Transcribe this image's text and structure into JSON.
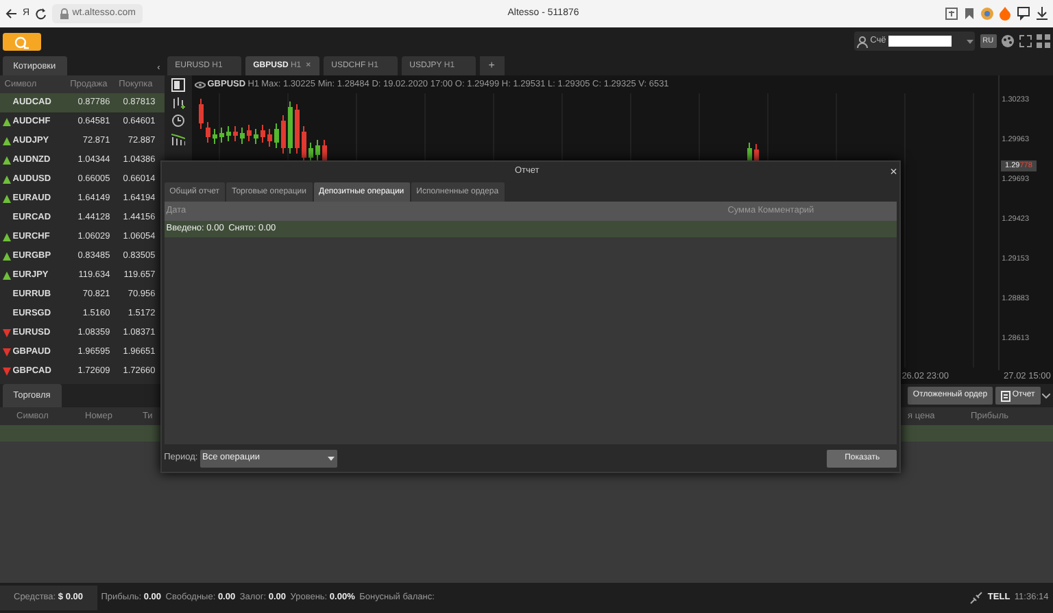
{
  "browser": {
    "logo_letter": "Я",
    "url": "wt.altesso.com",
    "title": "Altesso - 511876"
  },
  "header": {
    "account_prefix": "Счё",
    "language": "RU"
  },
  "quotes_panel": {
    "tab": "Котировки",
    "collapse": "‹",
    "columns": [
      "Символ",
      "Продажа",
      "Покупка"
    ],
    "rows": [
      {
        "symbol": "AUDCAD",
        "sell": "0.87786",
        "buy": "0.87813",
        "rising": false,
        "falling": false,
        "selected": true
      },
      {
        "symbol": "AUDCHF",
        "sell": "0.64581",
        "buy": "0.64601",
        "rising": true,
        "falling": false,
        "selected": false
      },
      {
        "symbol": "AUDJPY",
        "sell": "72.871",
        "buy": "72.887",
        "rising": true,
        "falling": false,
        "selected": false
      },
      {
        "symbol": "AUDNZD",
        "sell": "1.04344",
        "buy": "1.04386",
        "rising": true,
        "falling": false,
        "selected": false
      },
      {
        "symbol": "AUDUSD",
        "sell": "0.66005",
        "buy": "0.66014",
        "rising": true,
        "falling": false,
        "selected": false
      },
      {
        "symbol": "EURAUD",
        "sell": "1.64149",
        "buy": "1.64194",
        "rising": true,
        "falling": false,
        "selected": false
      },
      {
        "symbol": "EURCAD",
        "sell": "1.44128",
        "buy": "1.44156",
        "rising": false,
        "falling": false,
        "selected": false
      },
      {
        "symbol": "EURCHF",
        "sell": "1.06029",
        "buy": "1.06054",
        "rising": true,
        "falling": false,
        "selected": false
      },
      {
        "symbol": "EURGBP",
        "sell": "0.83485",
        "buy": "0.83505",
        "rising": true,
        "falling": false,
        "selected": false
      },
      {
        "symbol": "EURJPY",
        "sell": "119.634",
        "buy": "119.657",
        "rising": true,
        "falling": false,
        "selected": false
      },
      {
        "symbol": "EURRUB",
        "sell": "70.821",
        "buy": "70.956",
        "rising": false,
        "falling": false,
        "selected": false
      },
      {
        "symbol": "EURSGD",
        "sell": "1.5160",
        "buy": "1.5172",
        "rising": false,
        "falling": false,
        "selected": false
      },
      {
        "symbol": "EURUSD",
        "sell": "1.08359",
        "buy": "1.08371",
        "rising": false,
        "falling": true,
        "selected": false
      },
      {
        "symbol": "GBPAUD",
        "sell": "1.96595",
        "buy": "1.96651",
        "rising": false,
        "falling": true,
        "selected": false
      },
      {
        "symbol": "GBPCAD",
        "sell": "1.72609",
        "buy": "1.72660",
        "rising": false,
        "falling": true,
        "selected": false
      }
    ]
  },
  "chart_tabs": [
    {
      "label": "EURUSD",
      "timeframe": "H1",
      "selected": false
    },
    {
      "label": "GBPUSD",
      "timeframe": "H1",
      "selected": true,
      "close_mark": "×"
    },
    {
      "label": "USDCHF",
      "timeframe": "H1",
      "selected": false
    },
    {
      "label": "USDJPY",
      "timeframe": "H1",
      "selected": false
    }
  ],
  "add_tab": "+",
  "chart": {
    "symbol": "GBPUSD",
    "timeframe": "H1",
    "stats": [
      {
        "label": "Max:",
        "value": "1.30225"
      },
      {
        "label": "Min:",
        "value": "1.28484"
      },
      {
        "label": "D:",
        "value": "19.02.2020 17:00"
      },
      {
        "label": "O:",
        "value": "1.29499"
      },
      {
        "label": "H:",
        "value": "1.29531"
      },
      {
        "label": "L:",
        "value": "1.29305"
      },
      {
        "label": "C:",
        "value": "1.29325"
      },
      {
        "label": "V:",
        "value": "6531"
      }
    ],
    "price_labels": [
      "1.30233",
      "1.29963",
      "1.29693",
      "1.29423",
      "1.29153",
      "1.28883",
      "1.28613"
    ],
    "current_price_head": "1.29",
    "current_price_tail": "778",
    "time_labels": [
      "26.02 23:00",
      "27.02 15:00"
    ]
  },
  "trading_panel": {
    "tab": "Торговля",
    "columns_left": [
      "Символ",
      "Номер",
      "Ти"
    ],
    "columns_right": [
      "я цена",
      "Прибыль"
    ],
    "pending_order_button": "Отложенный ордер",
    "report_button": "Отчет"
  },
  "report_dialog": {
    "title": "Отчет",
    "close": "×",
    "tabs": [
      {
        "label": "Общий отчет",
        "selected": false
      },
      {
        "label": "Торговые операции",
        "selected": false
      },
      {
        "label": "Депозитные операции",
        "selected": true
      },
      {
        "label": "Исполненные ордера",
        "selected": false
      }
    ],
    "columns": [
      "Дата",
      "Сумма",
      "Комментарий"
    ],
    "summary": [
      {
        "label": "Введено:",
        "value": "0.00"
      },
      {
        "label": "Снято:",
        "value": "0.00"
      }
    ],
    "period_label": "Период:",
    "period_value": "Все операции",
    "show_button": "Показать"
  },
  "status_bar": {
    "items": [
      {
        "label": "Средства:",
        "value": "$ 0.00",
        "kind": "boxed"
      },
      {
        "label": "Прибыль:",
        "value": "0.00",
        "kind": "plain"
      },
      {
        "label": "Свободные:",
        "value": "0.00",
        "kind": "plain"
      },
      {
        "label": "Залог:",
        "value": "0.00",
        "kind": "plain"
      },
      {
        "label": "Уровень:",
        "value": "0.00%",
        "kind": "plain"
      },
      {
        "label": "Бонусный баланс:",
        "kind": "plain"
      }
    ],
    "server": "TELL",
    "time": "11:36:14"
  }
}
